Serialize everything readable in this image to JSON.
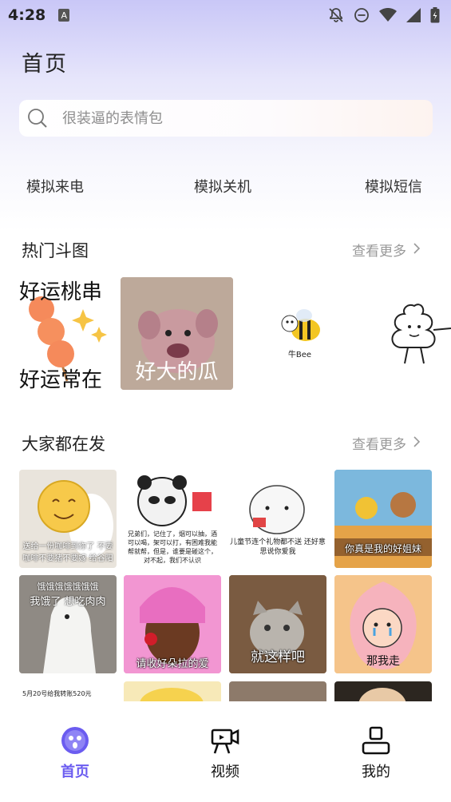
{
  "status_bar": {
    "time": "4:28",
    "left_badge": "A",
    "icons": [
      "notifications-off-icon",
      "do-not-disturb-icon",
      "wifi-icon",
      "signal-icon",
      "battery-icon"
    ]
  },
  "header": {
    "title": "首页"
  },
  "search": {
    "placeholder": "很装逼的表情包"
  },
  "quick_actions": [
    {
      "label": "模拟来电"
    },
    {
      "label": "模拟关机"
    },
    {
      "label": "模拟短信"
    }
  ],
  "hot_section": {
    "title": "热门斗图",
    "more": "查看更多",
    "cards": [
      {
        "top_text": "好运桃串",
        "bottom_text": "好运常在"
      },
      {
        "caption": "好大的瓜"
      },
      {
        "caption": "牛Bee"
      },
      {
        "caption": ""
      }
    ]
  },
  "popular_section": {
    "title": "大家都在发",
    "more": "查看更多",
    "tiles": [
      {
        "caption": "送给一份咖啡到你了 不要咖啡不要猪不要嫁 给谷阳"
      },
      {
        "caption": "兄弟们，记住了，烟可以抽，酒可以喝，架可以打，有困难我能帮就帮，但是，谁要是碰这个，对不起，我们不认识"
      },
      {
        "caption": "儿童节连个礼物都不送 还好意思说你爱我"
      },
      {
        "caption": "你真是我的好姐妹"
      },
      {
        "top_text": "饿饿饿饿饿饿饿",
        "mid_text": "我饿了 想吃肉肉",
        "caption": ""
      },
      {
        "caption": "请收好朵拉的爱"
      },
      {
        "caption": "就这样吧"
      },
      {
        "caption": "那我走"
      },
      {
        "caption": "5月20号给我转账520元"
      },
      {
        "caption": ""
      },
      {
        "caption": ""
      },
      {
        "caption": ""
      }
    ]
  },
  "tab_bar": {
    "tabs": [
      {
        "label": "首页",
        "active": true
      },
      {
        "label": "视频",
        "active": false
      },
      {
        "label": "我的",
        "active": false
      }
    ]
  },
  "colors": {
    "accent": "#6b5cf0",
    "gradient_top": "#c9c7f7",
    "muted_text": "#999999"
  }
}
